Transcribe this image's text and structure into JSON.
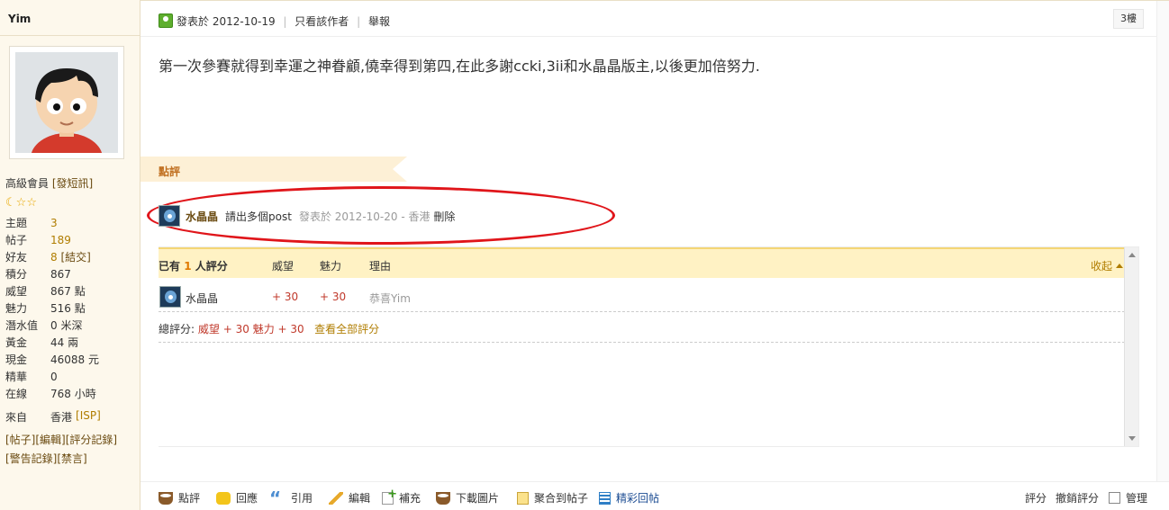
{
  "sidebar": {
    "username": "Yim",
    "rank": "高級會員",
    "send_pm": "[發短訊]",
    "stats": [
      {
        "label": "主題",
        "value": "3",
        "link": true
      },
      {
        "label": "帖子",
        "value": "189",
        "link": true
      },
      {
        "label": "好友",
        "value": "8",
        "link": true,
        "extra": "[結交]"
      },
      {
        "label": "積分",
        "value": "867"
      },
      {
        "label": "威望",
        "value": "867 點"
      },
      {
        "label": "魅力",
        "value": "516 點"
      },
      {
        "label": "潛水值",
        "value": "0 米深"
      },
      {
        "label": "黃金",
        "value": "44 兩"
      },
      {
        "label": "現金",
        "value": "46088 元"
      },
      {
        "label": "精華",
        "value": "0"
      },
      {
        "label": "在線",
        "value": "768 小時"
      }
    ],
    "from_label": "來自",
    "from_value": "香港",
    "from_isp": "[ISP]",
    "links": [
      "[帖子]",
      "[編輯]",
      "[評分記錄]",
      "[警告記錄]",
      "[禁言]"
    ]
  },
  "post": {
    "posted_label": "發表於",
    "date": "2012-10-19",
    "only_author": "只看該作者",
    "report": "舉報",
    "floor": "3樓",
    "body": "第一次參賽就得到幸運之神眷顧,僥幸得到第四,在此多謝ccki,3ii和水晶晶版主,以後更加倍努力."
  },
  "comments": {
    "header": "點評",
    "items": [
      {
        "author": "水晶晶",
        "text": "請出多個post",
        "posted_label": "發表於",
        "date": "2012-10-20",
        "location": "香港",
        "delete": "刪除"
      }
    ]
  },
  "rating": {
    "prefix": "已有",
    "count": "1",
    "suffix": "人評分",
    "col_prestige": "威望",
    "col_charm": "魅力",
    "col_reason": "理由",
    "collapse": "收起",
    "rows": [
      {
        "user": "水晶晶",
        "prestige": "+ 30",
        "charm": "+ 30",
        "reason": "恭喜Yim"
      }
    ],
    "total_label": "總評分:",
    "total_prestige_label": "威望",
    "total_prestige": "+ 30",
    "total_charm_label": "魅力",
    "total_charm": "+ 30",
    "view_all": "查看全部評分"
  },
  "actions": {
    "comment": "點評",
    "reply": "回應",
    "quote": "引用",
    "edit": "編輯",
    "supplement": "補充",
    "download_images": "下載圖片",
    "aggregate": "聚合到帖子",
    "featured_reply": "精彩回帖",
    "rate": "評分",
    "revoke_rate": "撤銷評分",
    "manage": "管理"
  }
}
